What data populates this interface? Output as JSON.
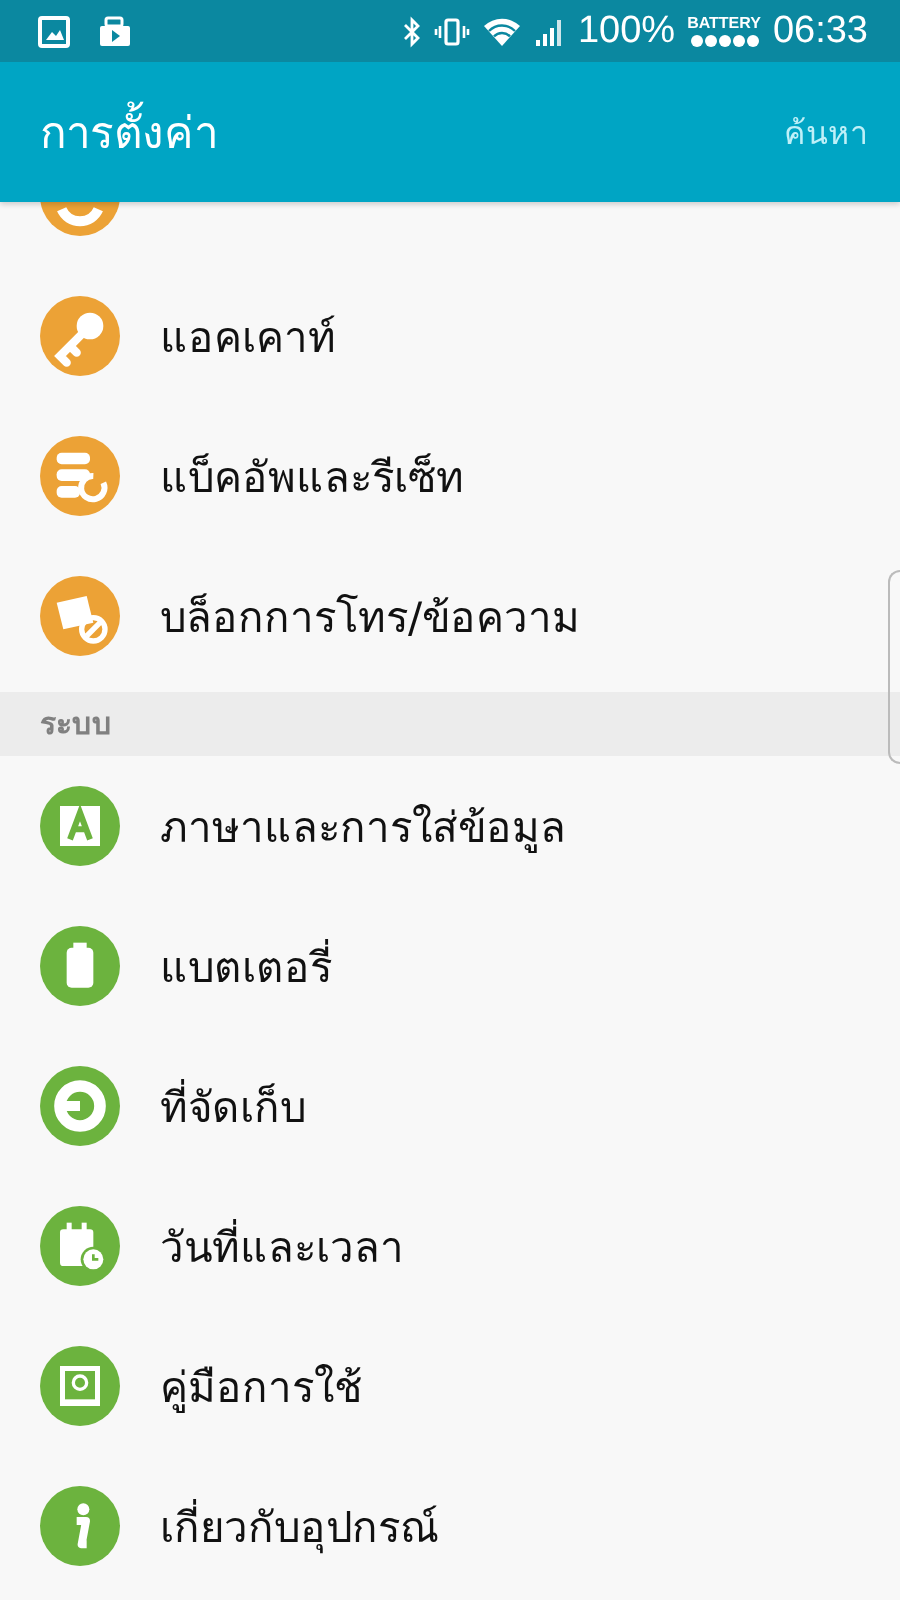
{
  "status_bar": {
    "battery_percent": "100%",
    "battery_label": "BATTERY",
    "time": "06:33"
  },
  "app_bar": {
    "title": "การตั้งค่า",
    "search": "ค้นหา"
  },
  "sections": [
    {
      "items": [
        {
          "kind": "cut",
          "color": "#eca236"
        },
        {
          "kind": "item",
          "label": "แอคเคาท์",
          "color": "#eca236"
        },
        {
          "kind": "item",
          "label": "แบ็คอัพและรีเซ็ท",
          "color": "#eca236"
        },
        {
          "kind": "item",
          "label": "บล็อกการโทร/ข้อความ",
          "color": "#eca236"
        }
      ]
    },
    {
      "header": "ระบบ",
      "items": [
        {
          "kind": "item",
          "label": "ภาษาและการใส่ข้อมูล",
          "color": "#6cb33e"
        },
        {
          "kind": "item",
          "label": "แบตเตอรี่",
          "color": "#6cb33e"
        },
        {
          "kind": "item",
          "label": "ที่จัดเก็บ",
          "color": "#6cb33e"
        },
        {
          "kind": "item",
          "label": "วันที่และเวลา",
          "color": "#6cb33e"
        },
        {
          "kind": "item",
          "label": "คู่มือการใช้",
          "color": "#6cb33e"
        },
        {
          "kind": "item",
          "label": "เกี่ยวกับอุปกรณ์",
          "color": "#6cb33e"
        }
      ]
    }
  ]
}
